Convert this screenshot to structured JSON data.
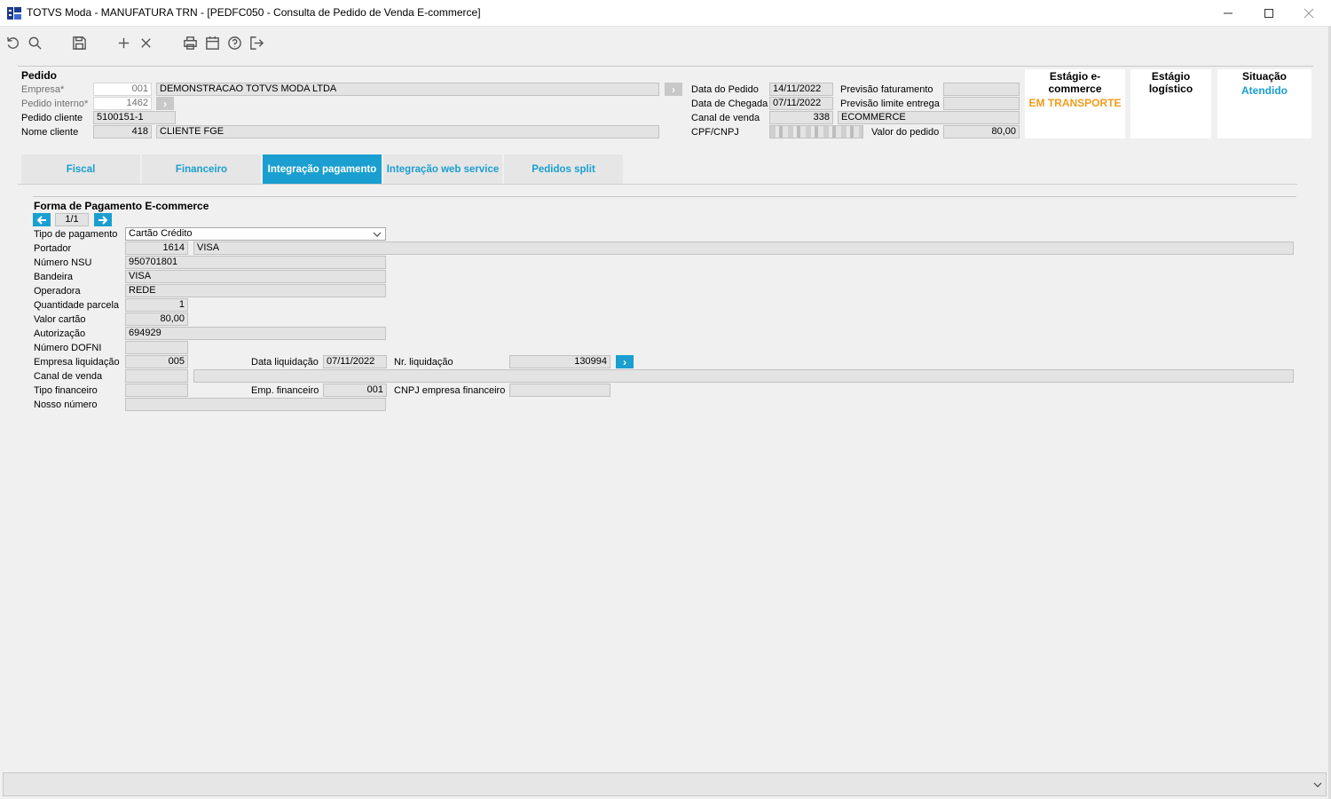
{
  "window": {
    "title": "TOTVS Moda - MANUFATURA TRN - [PEDFC050 - Consulta de Pedido de Venda E-commerce]"
  },
  "toolbar": {
    "icons": [
      "refresh-icon",
      "search-icon",
      "save-icon",
      "add-icon",
      "delete-icon",
      "print-icon",
      "calendar-icon",
      "help-icon",
      "exit-icon"
    ]
  },
  "pedido": {
    "section_title": "Pedido",
    "empresa_label": "Empresa*",
    "empresa_code": "001",
    "empresa_name": "DEMONSTRACAO TOTVS MODA LTDA",
    "pedido_interno_label": "Pedido interno*",
    "pedido_interno": "1462",
    "pedido_cliente_label": "Pedido cliente",
    "pedido_cliente": "5100151-1",
    "nome_cliente_label": "Nome cliente",
    "nome_cliente_code": "418",
    "nome_cliente": "CLIENTE FGE",
    "data_pedido_label": "Data do Pedido",
    "data_pedido": "14/11/2022",
    "data_chegada_label": "Data de Chegada",
    "data_chegada": "07/11/2022",
    "canal_venda_label": "Canal de venda",
    "canal_venda_code": "338",
    "canal_venda": "ECOMMERCE",
    "cpf_cnpj_label": "CPF/CNPJ",
    "previsao_faturamento_label": "Previsão faturamento",
    "previsao_faturamento": "",
    "previsao_limite_label": "Previsão limite entrega",
    "previsao_limite": "",
    "valor_pedido_label": "Valor do pedido",
    "valor_pedido": "80,00"
  },
  "stages": {
    "ecommerce_title": "Estágio e-commerce",
    "ecommerce_value": "EM TRANSPORTE",
    "logistico_title": "Estágio logístico",
    "logistico_value": "",
    "situacao_title": "Situação",
    "situacao_value": "Atendido",
    "colors": {
      "ecommerce": "#f29b1d",
      "situacao": "#1a9fd0"
    }
  },
  "tabs": [
    {
      "label": "Fiscal"
    },
    {
      "label": "Financeiro"
    },
    {
      "label": "Integração pagamento",
      "active": true
    },
    {
      "label": "Integração web service"
    },
    {
      "label": "Pedidos split"
    }
  ],
  "pagamento": {
    "section_title": "Forma de Pagamento E-commerce",
    "pager": "1/1",
    "tipo_pagamento_label": "Tipo de pagamento",
    "tipo_pagamento": "Cartão Crédito",
    "portador_label": "Portador",
    "portador_code": "1614",
    "portador_name": "VISA",
    "numero_nsu_label": "Número NSU",
    "numero_nsu": "950701801",
    "bandeira_label": "Bandeira",
    "bandeira": "VISA",
    "operadora_label": "Operadora",
    "operadora": "REDE",
    "quantidade_parcela_label": "Quantidade parcela",
    "quantidade_parcela": "1",
    "valor_cartao_label": "Valor cartão",
    "valor_cartao": "80,00",
    "autorizacao_label": "Autorização",
    "autorizacao": "694929",
    "numero_dofni_label": "Número DOFNI",
    "numero_dofni": "",
    "empresa_liquidacao_label": "Empresa liquidação",
    "empresa_liquidacao": "005",
    "data_liquidacao_label": "Data liquidação",
    "data_liquidacao": "07/11/2022",
    "nr_liquidacao_label": "Nr. liquidação",
    "nr_liquidacao": "130994",
    "canal_venda_label": "Canal de venda",
    "canal_venda_code": "",
    "canal_venda_name": "",
    "tipo_financeiro_label": "Tipo financeiro",
    "tipo_financeiro": "",
    "emp_financeiro_label": "Emp. financeiro",
    "emp_financeiro": "001",
    "cnpj_empresa_financeiro_label": "CNPJ empresa financeiro",
    "cnpj_empresa_financeiro": "",
    "nosso_numero_label": "Nosso número",
    "nosso_numero": ""
  },
  "statusbar": {
    "text": ""
  }
}
